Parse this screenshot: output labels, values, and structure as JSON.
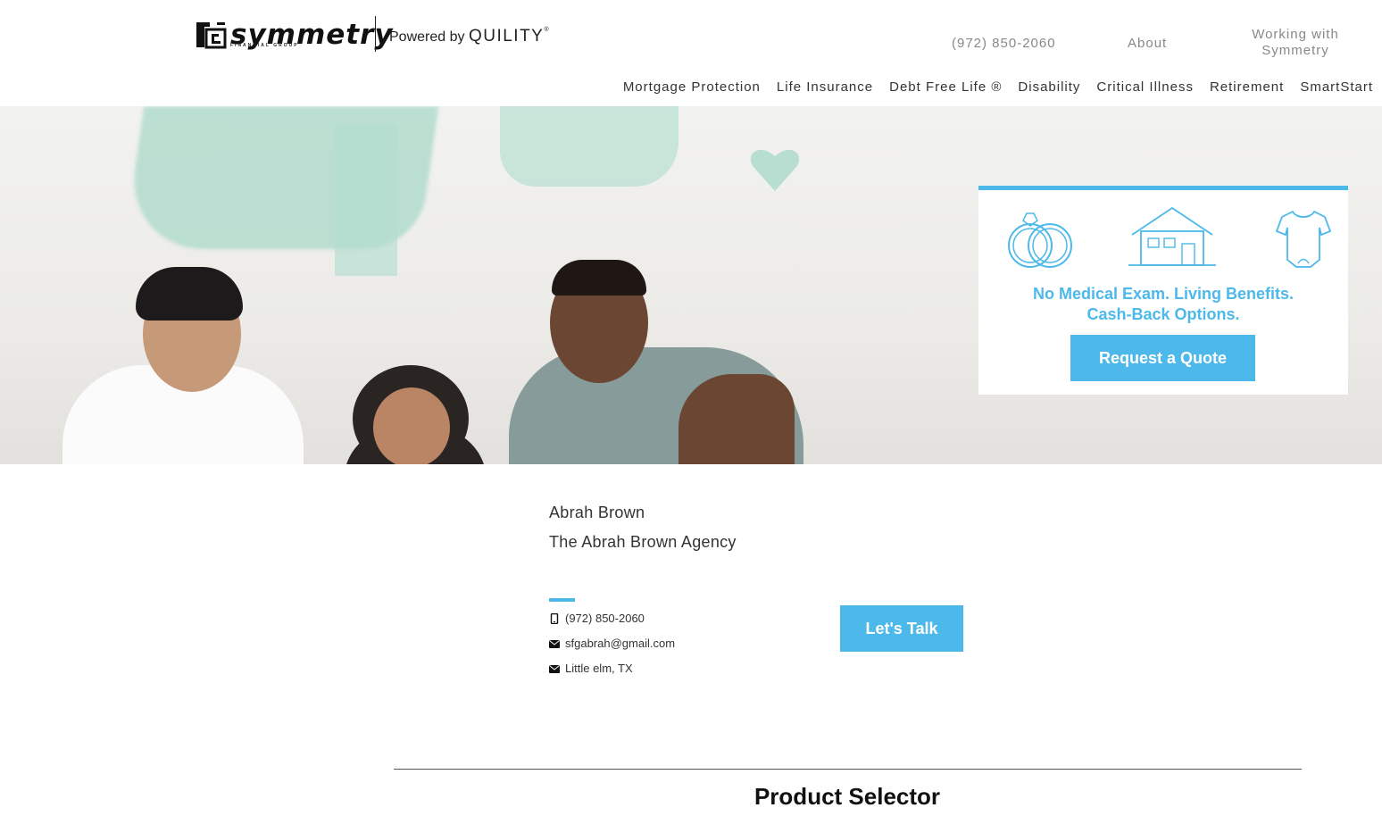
{
  "header": {
    "logo_text": "symmetry",
    "logo_subtext": "FINANCIAL GROUP",
    "powered_prefix": "Powered by",
    "powered_brand": "QUILITY",
    "powered_tm": "®",
    "phone_link": "(972) 850-2060",
    "about_link": "About",
    "working_link": "Working with Symmetry"
  },
  "nav": {
    "items": [
      {
        "label": "Mortgage Protection"
      },
      {
        "label": "Life Insurance"
      },
      {
        "label": "Debt Free Life ®"
      },
      {
        "label": "Disability"
      },
      {
        "label": "Critical Illness"
      },
      {
        "label": "Retirement"
      },
      {
        "label": "SmartStart"
      }
    ]
  },
  "quote_card": {
    "icons": [
      "rings-icon",
      "house-icon",
      "onesie-icon"
    ],
    "headline_line1": "No Medical Exam. Living Benefits.",
    "headline_line2": "Cash-Back Options.",
    "button_label": "Request a Quote",
    "accent_color": "#4db8ea"
  },
  "agent": {
    "name": "Abrah Brown",
    "agency": "The Abrah Brown Agency",
    "phone": "(972) 850-2060",
    "email": "sfgabrah@gmail.com",
    "location": "Little elm, TX",
    "cta_label": "Let's Talk"
  },
  "product_selector": {
    "title": "Product Selector"
  }
}
